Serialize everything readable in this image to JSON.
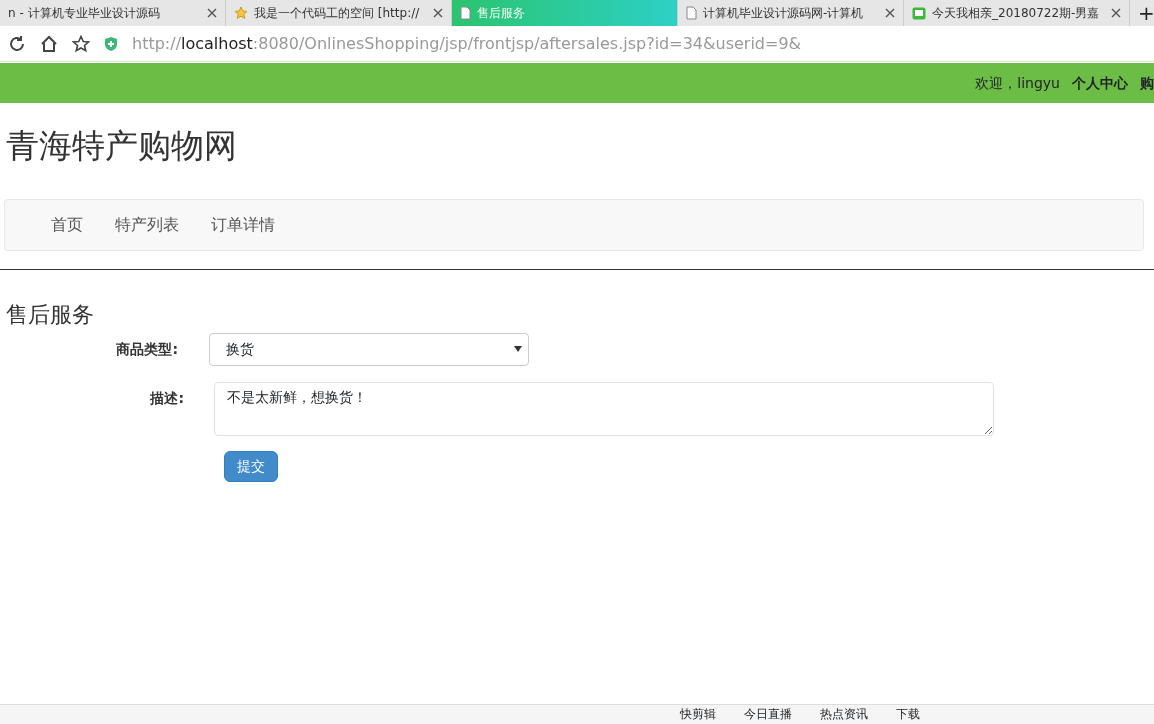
{
  "browser": {
    "tabs": [
      {
        "title": "n - 计算机专业毕业设计源码",
        "selected": false,
        "kind": "plain"
      },
      {
        "title": "我是一个代码工的空间 [http://",
        "selected": false,
        "kind": "star"
      },
      {
        "title": "售后服务",
        "selected": true,
        "kind": "page"
      },
      {
        "title": "计算机毕业设计源码网-计算机",
        "selected": false,
        "kind": "page"
      },
      {
        "title": "今天我相亲_20180722期-男嘉",
        "selected": false,
        "kind": "video"
      }
    ],
    "new_tab": "+",
    "url": {
      "scheme": "http://",
      "host": "localhost",
      "rest": ":8080/OnlinesShopping/jsp/frontjsp/aftersales.jsp?id=34&userid=9&"
    },
    "status_items": [
      "快剪辑",
      "今日直播",
      "热点资讯",
      "下载"
    ]
  },
  "top_bar": {
    "welcome": "欢迎，lingyu",
    "links": [
      "个人中心",
      "购"
    ]
  },
  "site_title": "青海特产购物网",
  "nav": [
    "首页",
    "特产列表",
    "订单详情"
  ],
  "heading": "售后服务",
  "form": {
    "type_label": "商品类型:",
    "type_value": "换货",
    "desc_label": "描述:",
    "desc_value": "不是太新鲜，想换货！",
    "submit": "提交"
  }
}
